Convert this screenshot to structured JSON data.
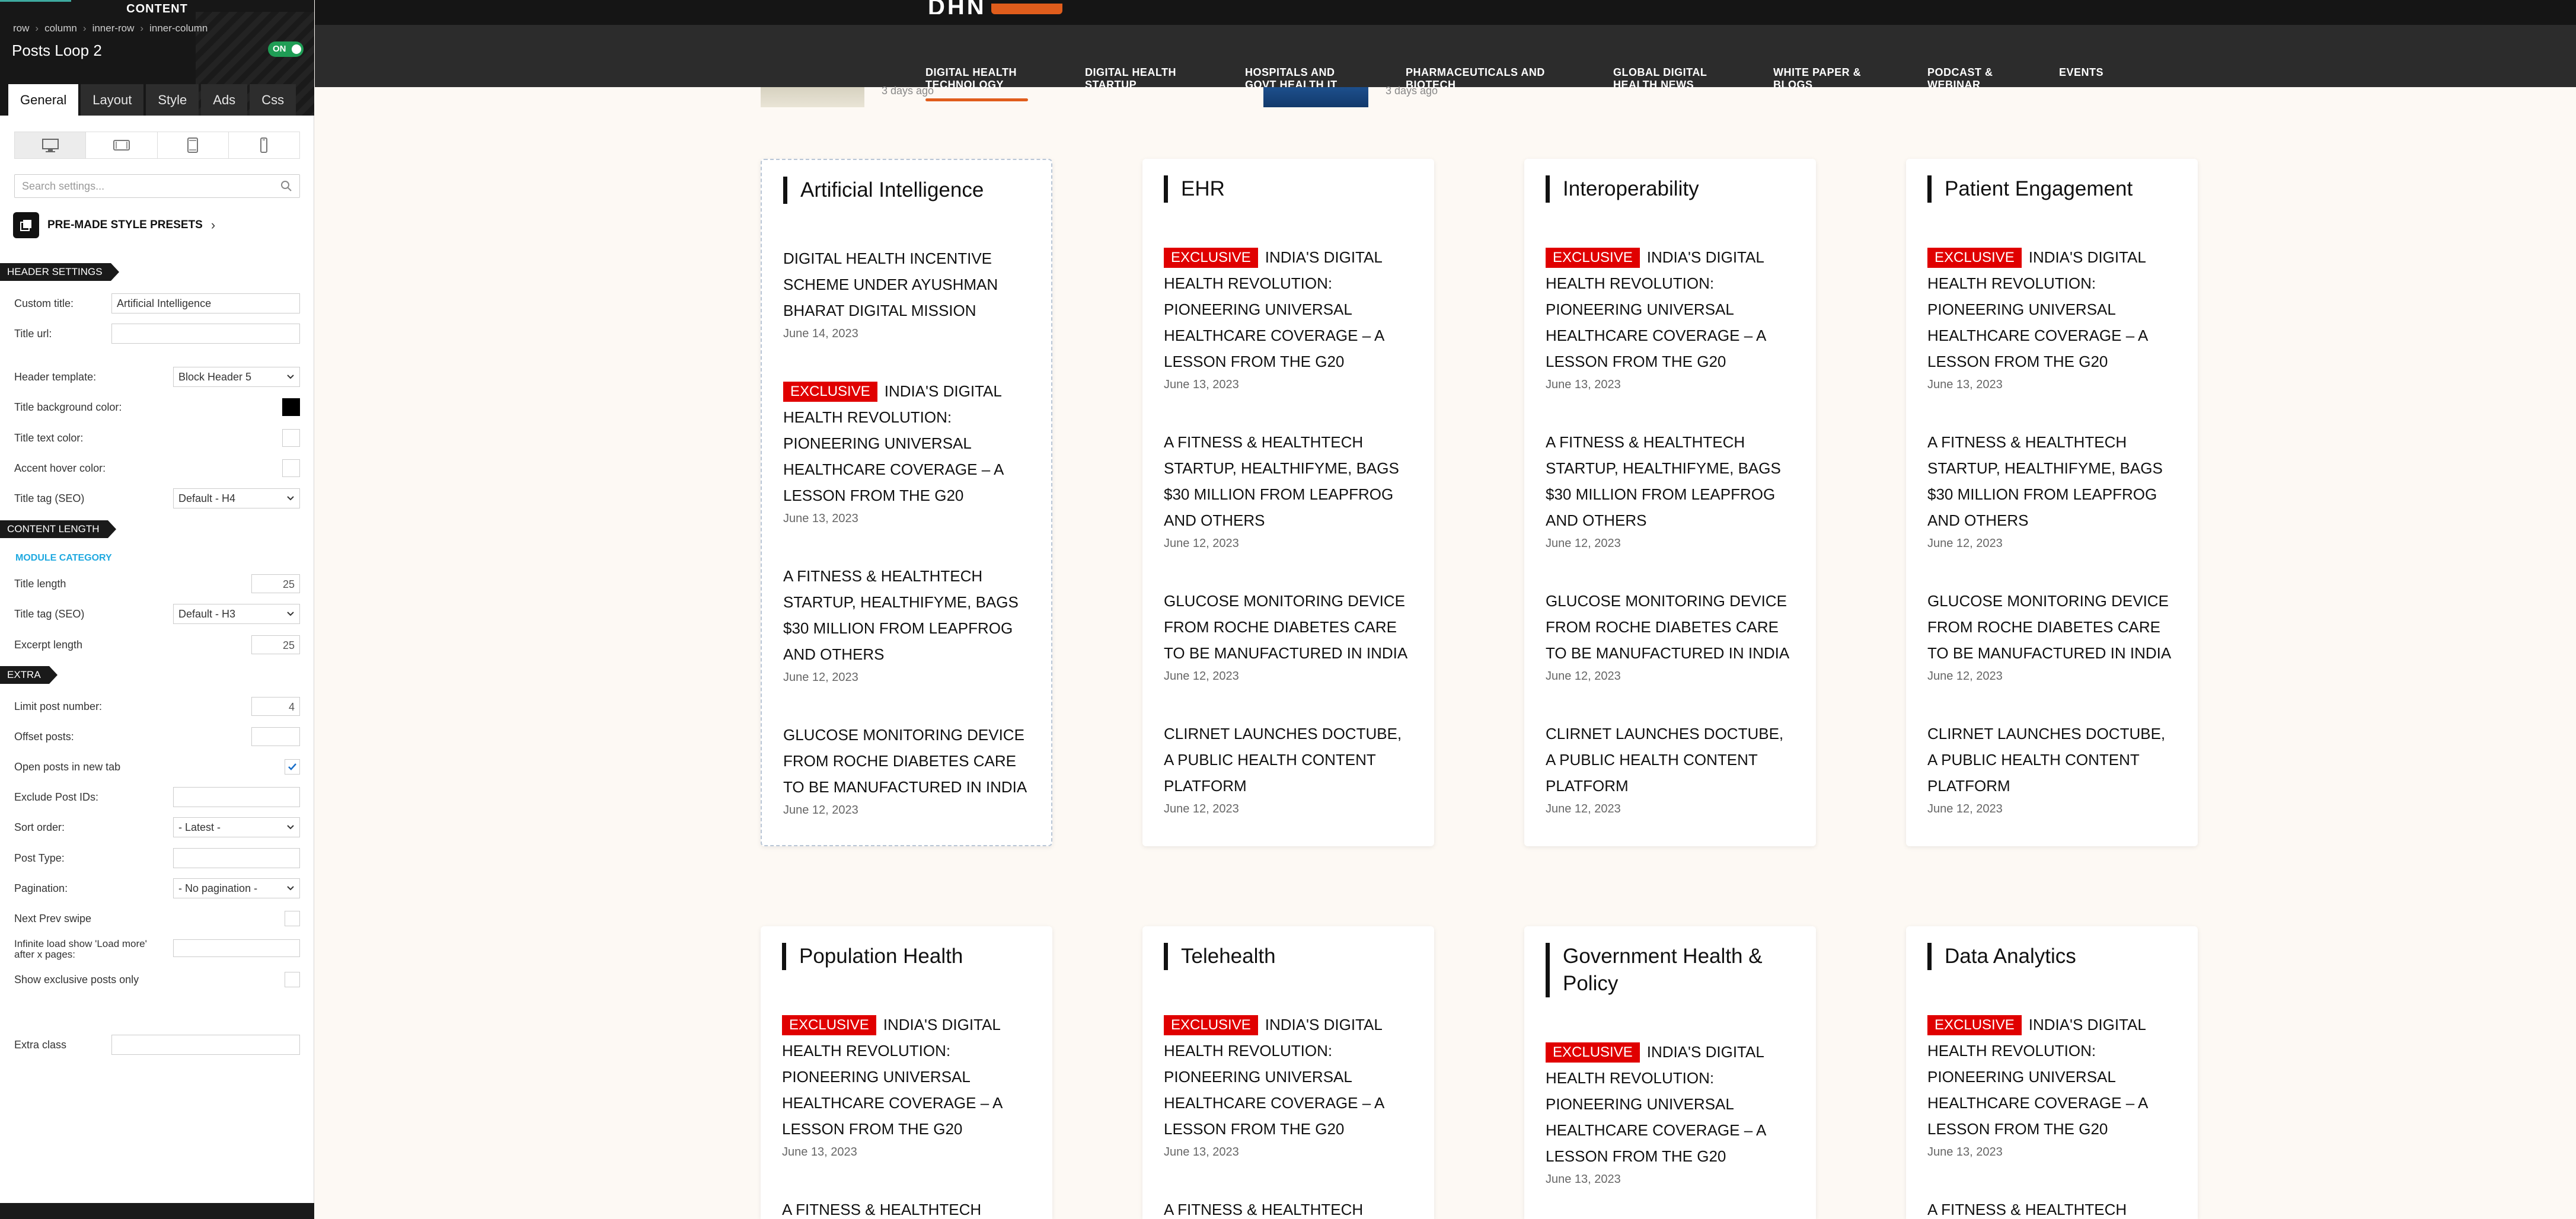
{
  "panel": {
    "header_label": "CONTENT",
    "breadcrumbs": [
      "row",
      "column",
      "inner-row",
      "inner-column"
    ],
    "title": "Posts Loop 2",
    "toggle_label": "ON",
    "tabs": [
      "General",
      "Layout",
      "Style",
      "Ads",
      "Css"
    ],
    "active_tab": "General",
    "search_placeholder": "Search settings...",
    "presets_label": "PRE-MADE STYLE PRESETS",
    "sections": {
      "header": "HEADER SETTINGS",
      "content_length": "CONTENT LENGTH",
      "module_category": "MODULE CATEGORY",
      "extra": "EXTRA"
    },
    "fields": {
      "custom_title_label": "Custom title:",
      "custom_title_value": "Artificial Intelligence",
      "title_url_label": "Title url:",
      "header_template_label": "Header template:",
      "header_template_value": "Block Header 5",
      "title_bg_label": "Title background color:",
      "title_text_color_label": "Title text color:",
      "accent_hover_label": "Accent hover color:",
      "title_tag_label": "Title tag (SEO)",
      "title_tag_value": "Default - H4",
      "title_length_label": "Title length",
      "title_length_value": "25",
      "title_tag2_label": "Title tag (SEO)",
      "title_tag2_value": "Default - H3",
      "excerpt_length_label": "Excerpt length",
      "excerpt_length_value": "25",
      "limit_label": "Limit post number:",
      "limit_value": "4",
      "offset_label": "Offset posts:",
      "open_new_tab_label": "Open posts in new tab",
      "exclude_ids_label": "Exclude Post IDs:",
      "sort_order_label": "Sort order:",
      "sort_order_value": "- Latest -",
      "post_type_label": "Post Type:",
      "pagination_label": "Pagination:",
      "pagination_value": "- No pagination -",
      "next_prev_label": "Next Prev swipe",
      "infinite_label": "Infinite load show 'Load more' after x pages:",
      "exclusive_only_label": "Show exclusive posts only",
      "extra_class_label": "Extra class"
    },
    "colors": {
      "title_background": "#000000"
    }
  },
  "nav": {
    "items": [
      {
        "line1": "DIGITAL HEALTH",
        "line2": "TECHNOLOGY",
        "active": true
      },
      {
        "line1": "DIGITAL HEALTH",
        "line2": "STARTUP"
      },
      {
        "line1": "HOSPITALS AND",
        "line2": "GOVT HEALTH IT"
      },
      {
        "line1": "PHARMACEUTICALS AND",
        "line2": "BIOTECH"
      },
      {
        "line1": "GLOBAL DIGITAL",
        "line2": "HEALTH NEWS"
      },
      {
        "line1": "WHITE PAPER &",
        "line2": "BLOGS"
      },
      {
        "line1": "PODCAST &",
        "line2": "WEBINAR"
      },
      {
        "line1": "EVENTS",
        "line2": ""
      }
    ],
    "accent_color": "#e05d1c"
  },
  "peek": {
    "date1": "3 days ago",
    "date2": "3 days ago"
  },
  "posts": {
    "p1": "Digital Health Incentive Scheme under Ayushman Bharat Digital Mission",
    "p2": "India's Digital Health Revolution: Pioneering Universal Healthcare Coverage – A Lesson from the G20",
    "p3": "A Fitness & Healthtech Startup, HealthifyMe, Bags $30 Million from LeapFrog and Others",
    "p4": "Glucose Monitoring Device from Roche Diabetes Care to be Manufactured in India",
    "p5": "Clirnet Launches DocTube, a Public Health Content Platform",
    "p3_short": "A Fitness & Healthtech",
    "exclusive": "EXCLUSIVE",
    "d1": "June 14, 2023",
    "d2": "June 13, 2023",
    "d3": "June 12, 2023"
  },
  "cards": [
    {
      "title": "Artificial Intelligence"
    },
    {
      "title": "EHR"
    },
    {
      "title": "Interoperability"
    },
    {
      "title": "Patient Engagement"
    },
    {
      "title": "Population Health"
    },
    {
      "title": "Telehealth"
    },
    {
      "title": "Government Health & Policy"
    },
    {
      "title": "Data Analytics"
    }
  ],
  "exclusive_color": "#e00000"
}
